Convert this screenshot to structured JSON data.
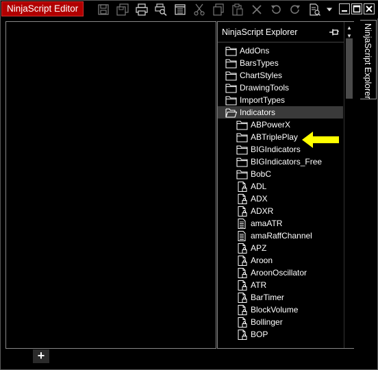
{
  "window": {
    "title": "NinjaScript Editor"
  },
  "toolbar": {
    "icons": [
      "save-icon",
      "save-all-icon",
      "print-icon",
      "print-preview-icon",
      "properties-icon",
      "cut-icon",
      "copy-icon",
      "paste-icon",
      "delete-icon",
      "undo-icon",
      "redo-icon",
      "compile-icon",
      "dropdown-icon"
    ]
  },
  "window_controls": [
    "minimize-icon",
    "maximize-icon",
    "close-icon"
  ],
  "explorer": {
    "title": "NinjaScript Explorer",
    "side_tab_label": "NinjaScript Explorer",
    "items": [
      {
        "label": "AddOns",
        "type": "folder",
        "level": 0
      },
      {
        "label": "BarsTypes",
        "type": "folder",
        "level": 0
      },
      {
        "label": "ChartStyles",
        "type": "folder",
        "level": 0
      },
      {
        "label": "DrawingTools",
        "type": "folder",
        "level": 0
      },
      {
        "label": "ImportTypes",
        "type": "folder",
        "level": 0
      },
      {
        "label": "Indicators",
        "type": "folder-open",
        "level": 0,
        "selected": true
      },
      {
        "label": "ABPowerX",
        "type": "folder",
        "level": 1
      },
      {
        "label": "ABTriplePlay",
        "type": "folder",
        "level": 1
      },
      {
        "label": "BIGIndicators",
        "type": "folder",
        "level": 1
      },
      {
        "label": "BIGIndicators_Free",
        "type": "folder",
        "level": 1
      },
      {
        "label": "BobC",
        "type": "folder",
        "level": 1
      },
      {
        "label": "ADL",
        "type": "file-locked",
        "level": 1
      },
      {
        "label": "ADX",
        "type": "file-locked",
        "level": 1
      },
      {
        "label": "ADXR",
        "type": "file-locked",
        "level": 1
      },
      {
        "label": "amaATR",
        "type": "file-text",
        "level": 1
      },
      {
        "label": "amaRaffChannel",
        "type": "file-text",
        "level": 1
      },
      {
        "label": "APZ",
        "type": "file-locked",
        "level": 1
      },
      {
        "label": "Aroon",
        "type": "file-locked",
        "level": 1
      },
      {
        "label": "AroonOscillator",
        "type": "file-locked",
        "level": 1
      },
      {
        "label": "ATR",
        "type": "file-locked",
        "level": 1
      },
      {
        "label": "BarTimer",
        "type": "file-locked",
        "level": 1
      },
      {
        "label": "BlockVolume",
        "type": "file-locked",
        "level": 1
      },
      {
        "label": "Bollinger",
        "type": "file-locked",
        "level": 1
      },
      {
        "label": "BOP",
        "type": "file-locked",
        "level": 1
      }
    ]
  },
  "editor": {
    "add_tab_label": "+"
  },
  "annotation": {
    "arrow_color": "#ffff00",
    "points_to": "ABTriplePlay"
  },
  "colors": {
    "title_tab_bg": "#b10000",
    "selected_row_bg": "#3a3a3a",
    "background": "#000000"
  }
}
